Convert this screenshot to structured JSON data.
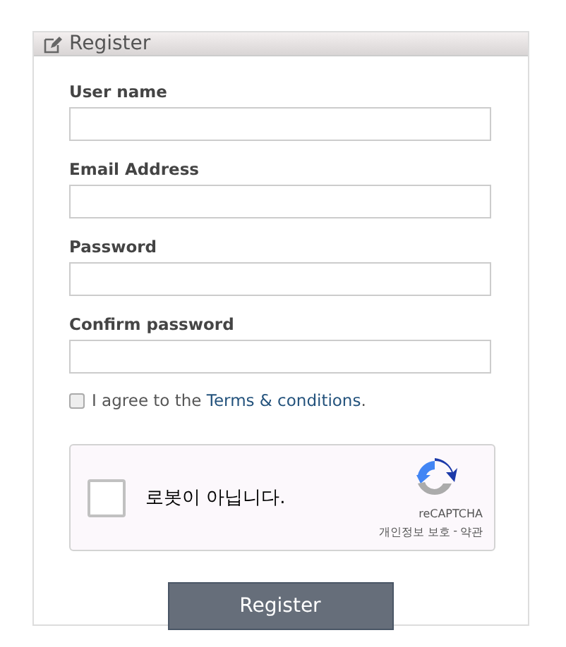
{
  "panel": {
    "title": "Register"
  },
  "fields": [
    {
      "label": "User name"
    },
    {
      "label": "Email Address"
    },
    {
      "label": "Password"
    },
    {
      "label": "Confirm password"
    }
  ],
  "agree": {
    "checked": false,
    "prefix": "I agree to the ",
    "link": "Terms & conditions",
    "suffix": "."
  },
  "captcha": {
    "checked": false,
    "label": "로봇이 아닙니다.",
    "brand": "reCAPTCHA",
    "privacy": "개인정보 보호",
    "separator": "-",
    "terms": "약관"
  },
  "submit": "Register"
}
